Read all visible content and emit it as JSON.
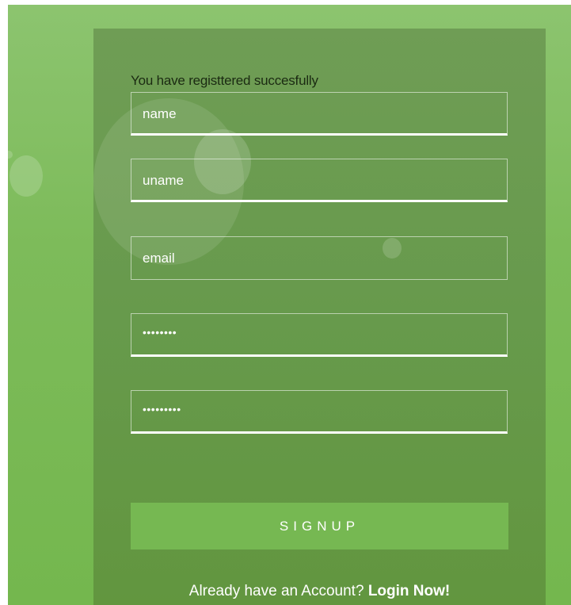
{
  "message": {
    "success": "You have registtered succesfully"
  },
  "form": {
    "fields": [
      {
        "name": "name",
        "value": "name"
      },
      {
        "name": "uname",
        "value": "uname"
      },
      {
        "name": "email",
        "value": "email"
      },
      {
        "name": "password",
        "value": "••••••••"
      },
      {
        "name": "confirm_password",
        "value": "•••••••••"
      }
    ],
    "submit_label": "SIGNUP"
  },
  "footer": {
    "prompt": "Already have an Account? ",
    "link": "Login Now!"
  },
  "colors": {
    "background": "#8cc46f",
    "card": "#679a4c",
    "button": "#76b852",
    "text_light": "#ffffff",
    "text_dark": "#1b2a12"
  }
}
